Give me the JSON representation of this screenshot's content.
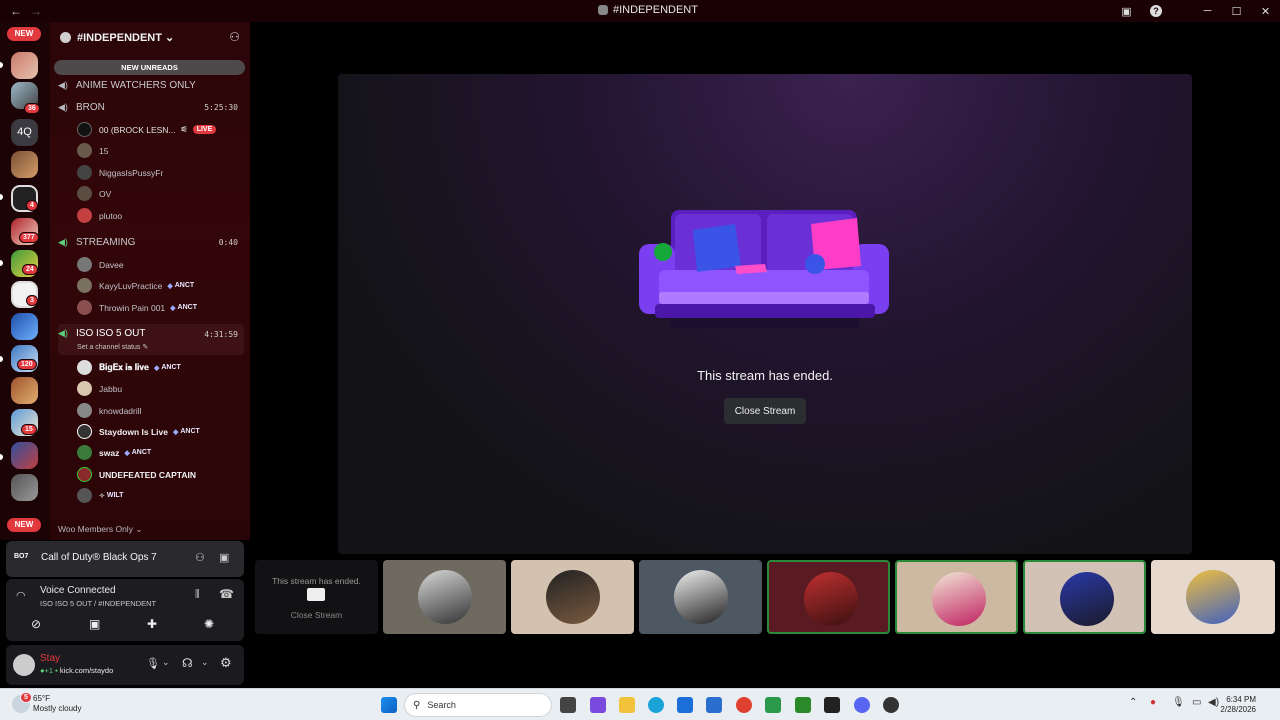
{
  "window": {
    "title": "#INDEPENDENT",
    "back": "←",
    "forward": "→"
  },
  "rail": {
    "new_top": "NEW",
    "new_bottom": "NEW",
    "text_server": "4Q",
    "badges": [
      "36",
      "4",
      "377",
      "24",
      "3",
      "120",
      "15"
    ]
  },
  "server": {
    "name": "#INDEPENDENT",
    "caret": "⌄"
  },
  "new_unreads": "NEW UNREADS",
  "channels": [
    {
      "name": "ANIME WATCHERS ONLY",
      "timer": ""
    },
    {
      "name": "BRON",
      "timer": "5:25:30",
      "users": [
        {
          "name": "00 (BROCK LESN...",
          "live": "LIVE"
        },
        {
          "name": "15"
        },
        {
          "name": "NiggasIsPussyFr"
        },
        {
          "name": "OV"
        },
        {
          "name": "plutoo"
        }
      ]
    },
    {
      "name": "STREAMING",
      "timer": "0:40",
      "users": [
        {
          "name": "Davee"
        },
        {
          "name": "KayyLuvPractice",
          "tag": "ANCT"
        },
        {
          "name": "Throwin Pain 001",
          "tag": "ANCT"
        }
      ]
    },
    {
      "name": "ISO ISO 5 OUT",
      "timer": "4:31:59",
      "status": "Set a channel status",
      "users": [
        {
          "name": "𝐁𝐢𝐠𝐄𝐱 𝐢𝐬 𝐥𝐢𝐯𝐞",
          "tag": "ANCT"
        },
        {
          "name": "Jabbu"
        },
        {
          "name": "knowdadrill"
        },
        {
          "name": "Staydown Is Live",
          "tag": "ANCT"
        },
        {
          "name": "swaz",
          "tag": "ANCT"
        },
        {
          "name": "UNDEFEATED CAPTAIN"
        },
        {
          "name": "WILT"
        }
      ]
    }
  ],
  "category": "Woo Members Only",
  "activity": {
    "game": "Call of Duty® Black Ops 7"
  },
  "voice": {
    "status": "Voice Connected",
    "location": "ISO ISO 5 OUT / #INDEPENDENT"
  },
  "user": {
    "name": "Stay",
    "status": "kick.com/staydo"
  },
  "stage": {
    "message": "This stream has ended.",
    "button": "Close Stream"
  },
  "mini": {
    "message": "This stream has ended.",
    "button": "Close Stream"
  },
  "taskbar": {
    "temp": "65°F",
    "weather": "Mostly cloudy",
    "weather_badge": "5",
    "search": "Search",
    "time": "6:34 PM",
    "date": "2/28/2026"
  },
  "colors": {
    "accent": "#e2393f",
    "sidebar": "#2b0508",
    "stage": "#241532"
  }
}
